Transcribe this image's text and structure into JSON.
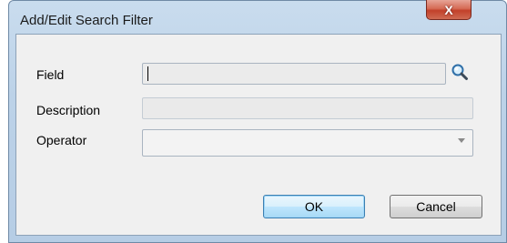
{
  "window": {
    "title": "Add/Edit Search Filter",
    "close_glyph": "X"
  },
  "form": {
    "field": {
      "label": "Field",
      "value": ""
    },
    "description": {
      "label": "Description",
      "value": ""
    },
    "operator": {
      "label": "Operator",
      "value": ""
    }
  },
  "icons": {
    "search": "magnifier-icon",
    "dropdown": "chevron-down-icon"
  },
  "buttons": {
    "ok": "OK",
    "cancel": "Cancel"
  },
  "colors": {
    "titlebar": "#c4d9ee",
    "close": "#c94a33",
    "ok_accent": "#3c7fb1"
  }
}
